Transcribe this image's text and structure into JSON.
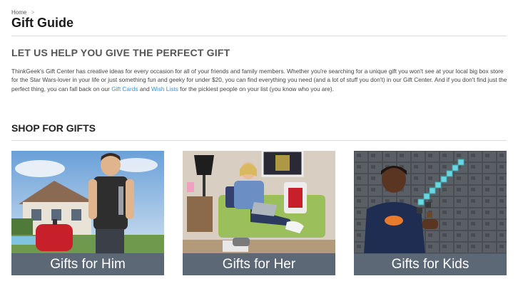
{
  "breadcrumb": {
    "home": "Home",
    "separator": ">"
  },
  "page": {
    "title": "Gift Guide"
  },
  "intro": {
    "heading": "LET US HELP YOU GIVE THE PERFECT GIFT",
    "text_part1": "ThinkGeek's Gift Center has creative ideas for every occasion for all of your friends and family members. Whether you're searching for a unique gift you won't see at your local big box store for the Star Wars-lover in your life or just something fun and geeky for under $20, you can find everything you need (and a lot of stuff you don't) in our Gift Center. And if you don't find just the perfect thing, you can fall back on our ",
    "link_gift_cards": "Gift Cards",
    "text_and": " and ",
    "link_wish_lists": "Wish Lists",
    "text_part2": " for the pickiest people on your list (you know who you are)."
  },
  "shop": {
    "heading": "SHOP FOR GIFTS",
    "cards": [
      {
        "label": "Gifts for Him"
      },
      {
        "label": "Gifts for Her"
      },
      {
        "label": "Gifts for Kids"
      }
    ]
  },
  "colors": {
    "link": "#3b8fc7",
    "label_bar": "#525f6e"
  }
}
